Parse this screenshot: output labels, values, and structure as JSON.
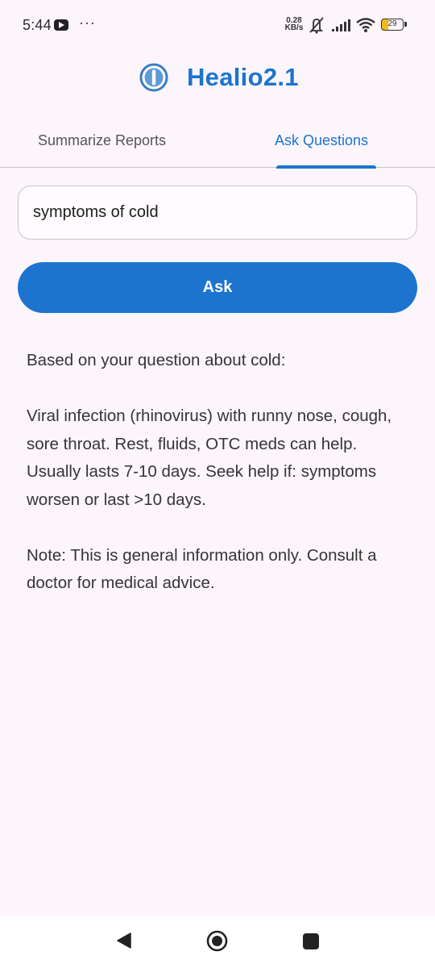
{
  "status_bar": {
    "time": "5:44",
    "more": "···",
    "net_speed_value": "0.28",
    "net_speed_unit": "KB/s",
    "battery": "29",
    "icons": [
      "youtube-icon",
      "mute-icon",
      "signal-icon",
      "wifi-icon",
      "battery-icon"
    ]
  },
  "header": {
    "title": "Healio2.1",
    "accent_color": "#1c74cf"
  },
  "tabs": [
    {
      "label": "Summarize Reports",
      "selected": false
    },
    {
      "label": "Ask Questions",
      "selected": true
    }
  ],
  "question": {
    "value": "symptoms of cold"
  },
  "ask_button": {
    "label": "Ask"
  },
  "answer": {
    "intro": "Based on your question about cold:",
    "body": "Viral infection (rhinovirus) with runny nose, cough, sore throat. Rest, fluids, OTC meds can help. Usually lasts 7-10 days. Seek help if: symptoms worsen or last >10 days.",
    "note": "Note: This is general information only. Consult a doctor for medical advice."
  },
  "nav_bar": {
    "icons": [
      "back-icon",
      "home-icon",
      "recents-icon"
    ]
  }
}
